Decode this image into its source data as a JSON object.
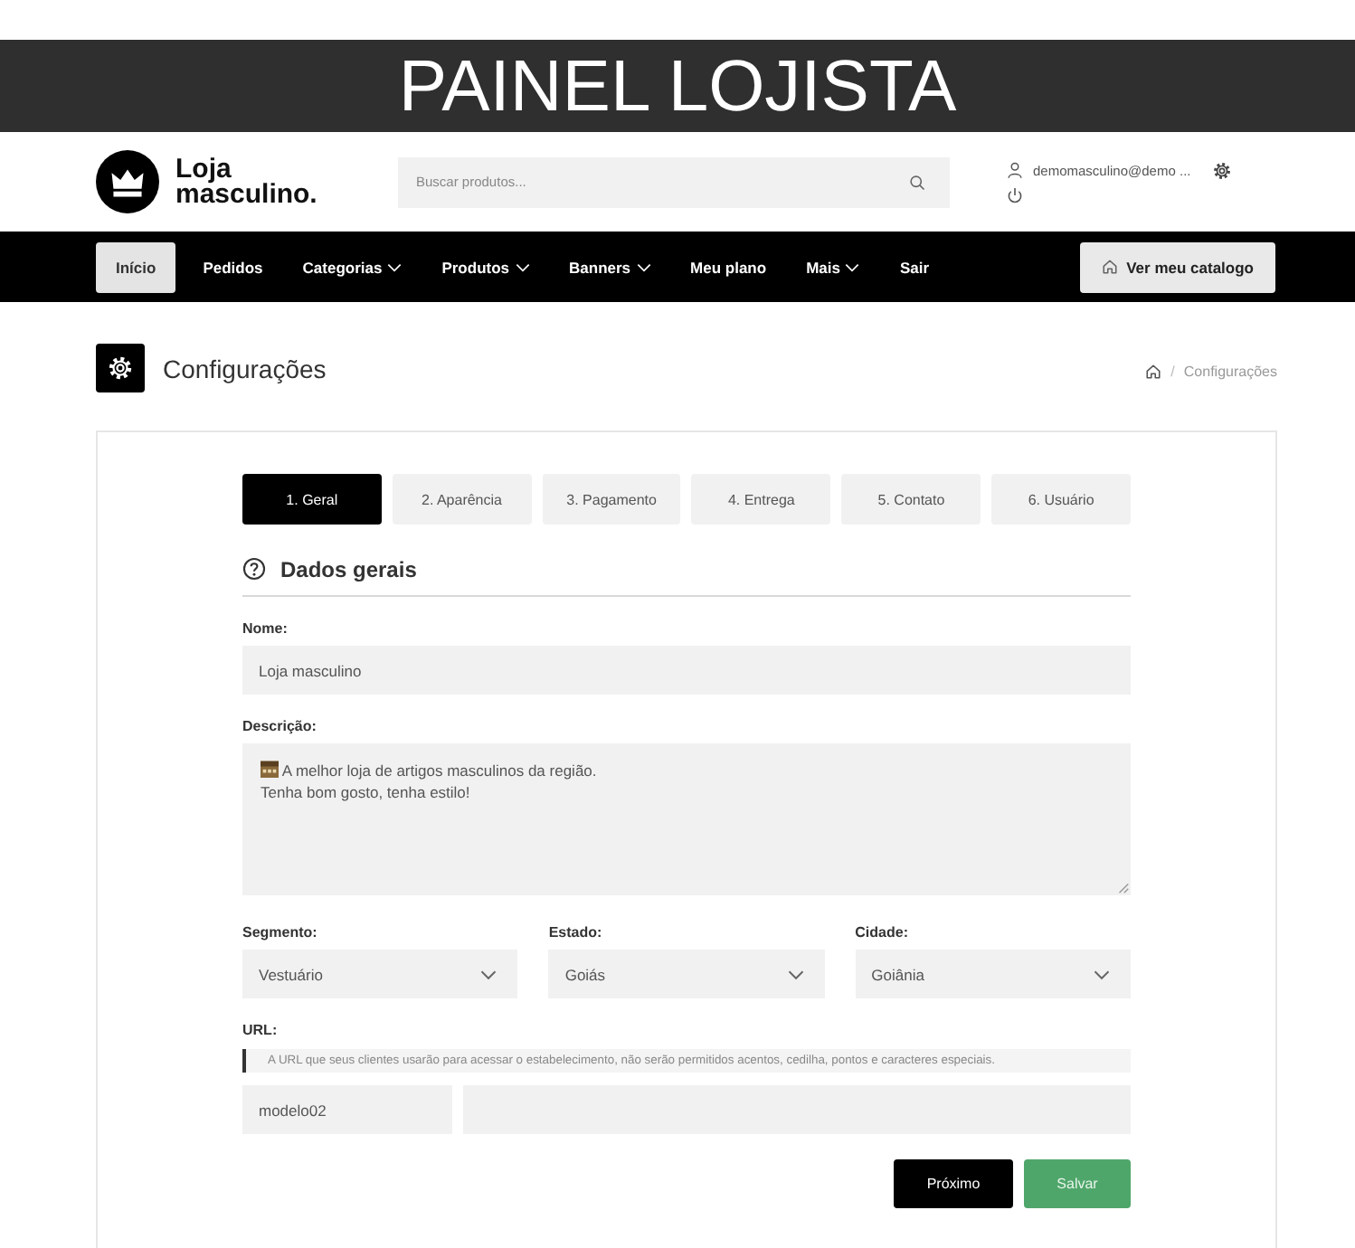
{
  "banner": {
    "title": "PAINEL LOJISTA"
  },
  "header": {
    "logo_text": "Loja masculino.",
    "search": {
      "placeholder": "Buscar produtos..."
    },
    "user": {
      "email": "demomasculino@demo ..."
    }
  },
  "nav": {
    "items": [
      {
        "label": "Início",
        "selected": true,
        "dropdown": false
      },
      {
        "label": "Pedidos",
        "selected": false,
        "dropdown": false
      },
      {
        "label": "Categorias",
        "selected": false,
        "dropdown": true
      },
      {
        "label": "Produtos",
        "selected": false,
        "dropdown": true
      },
      {
        "label": "Banners",
        "selected": false,
        "dropdown": true
      },
      {
        "label": "Meu plano",
        "selected": false,
        "dropdown": false
      },
      {
        "label": "Mais",
        "selected": false,
        "dropdown": true
      },
      {
        "label": "Sair",
        "selected": false,
        "dropdown": false
      }
    ],
    "catalog_button": "Ver meu catalogo"
  },
  "page": {
    "title": "Configurações",
    "breadcrumb": {
      "separator": "/",
      "current": "Configurações"
    }
  },
  "tabs": [
    {
      "label": "1. Geral",
      "selected": true
    },
    {
      "label": "2. Aparência",
      "selected": false
    },
    {
      "label": "3. Pagamento",
      "selected": false
    },
    {
      "label": "4. Entrega",
      "selected": false
    },
    {
      "label": "5. Contato",
      "selected": false
    },
    {
      "label": "6. Usuário",
      "selected": false
    }
  ],
  "section": {
    "title": "Dados gerais"
  },
  "form": {
    "name": {
      "label": "Nome:",
      "value": "Loja masculino"
    },
    "description": {
      "label": "Descrição:",
      "value": "A melhor loja de artigos masculinos da região.\nTenha bom gosto, tenha estilo!"
    },
    "selects": [
      {
        "label": "Segmento:",
        "value": "Vestuário"
      },
      {
        "label": "Estado:",
        "value": "Goiás"
      },
      {
        "label": "Cidade:",
        "value": "Goiânia"
      }
    ],
    "url": {
      "label": "URL:",
      "hint": "A URL que seus clientes usarão para acessar o estabelecimento, não serão permitidos acentos, cedilha, pontos e caracteres especiais.",
      "slug": "modelo02"
    }
  },
  "buttons": [
    {
      "label": "Próximo",
      "kind": "dark"
    },
    {
      "label": "Salvar",
      "kind": "success"
    }
  ]
}
